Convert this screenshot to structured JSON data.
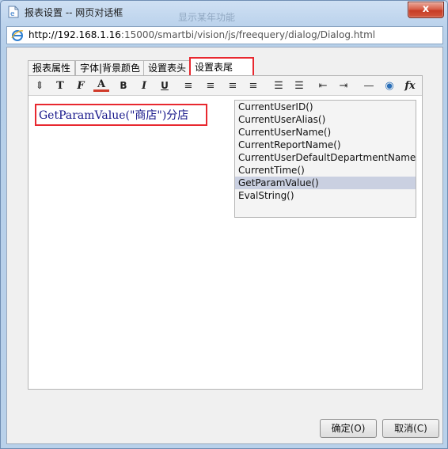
{
  "window": {
    "title": "报表设置 -- 网页对话框",
    "background_title": "显示某年功能",
    "close_label": "x"
  },
  "addressbar": {
    "url_host": "http://192.168.1.16",
    "url_rest": ":15000/smartbi/vision/js/freequery/dialog/Dialog.html"
  },
  "tabs": [
    {
      "label": "报表属性"
    },
    {
      "label": "字体|背景颜色"
    },
    {
      "label": "设置表头"
    },
    {
      "label": "设置表尾",
      "active": true
    }
  ],
  "toolbar": {
    "items": [
      {
        "icon": "line-height-icon",
        "glyph": "⇕"
      },
      {
        "icon": "font-size-icon",
        "glyph": "T"
      },
      {
        "icon": "font-family-icon",
        "glyph": "F"
      },
      {
        "icon": "font-color-icon",
        "glyph": "A"
      },
      {
        "icon": "bold-icon",
        "glyph": "B"
      },
      {
        "icon": "italic-icon",
        "glyph": "I"
      },
      {
        "icon": "underline-icon",
        "glyph": "U"
      },
      {
        "icon": "align-left-icon",
        "glyph": "≡"
      },
      {
        "icon": "align-center-icon",
        "glyph": "≡"
      },
      {
        "icon": "align-right-icon",
        "glyph": "≡"
      },
      {
        "icon": "justify-icon",
        "glyph": "≡"
      },
      {
        "icon": "ordered-list-icon",
        "glyph": "☰"
      },
      {
        "icon": "unordered-list-icon",
        "glyph": "☰"
      },
      {
        "icon": "outdent-icon",
        "glyph": "⇤"
      },
      {
        "icon": "indent-icon",
        "glyph": "⇥"
      },
      {
        "icon": "horizontal-rule-icon",
        "glyph": "—"
      },
      {
        "icon": "link-icon",
        "glyph": "◉"
      },
      {
        "icon": "function-icon",
        "glyph": "fx"
      }
    ]
  },
  "editor": {
    "value": "GetParamValue(\"商店\")分店"
  },
  "functions": [
    {
      "label": "CurrentUserID()"
    },
    {
      "label": "CurrentUserAlias()"
    },
    {
      "label": "CurrentUserName()"
    },
    {
      "label": "CurrentReportName()"
    },
    {
      "label": "CurrentUserDefaultDepartmentName()"
    },
    {
      "label": "CurrentTime()"
    },
    {
      "label": "GetParamValue()",
      "selected": true
    },
    {
      "label": "EvalString()"
    }
  ],
  "buttons": {
    "ok_label": "确定(O)",
    "cancel_label": "取消(C)"
  },
  "colors": {
    "highlight_red": "#e8282f",
    "editor_text": "#16168a",
    "selected_row": "#cad0e1"
  }
}
